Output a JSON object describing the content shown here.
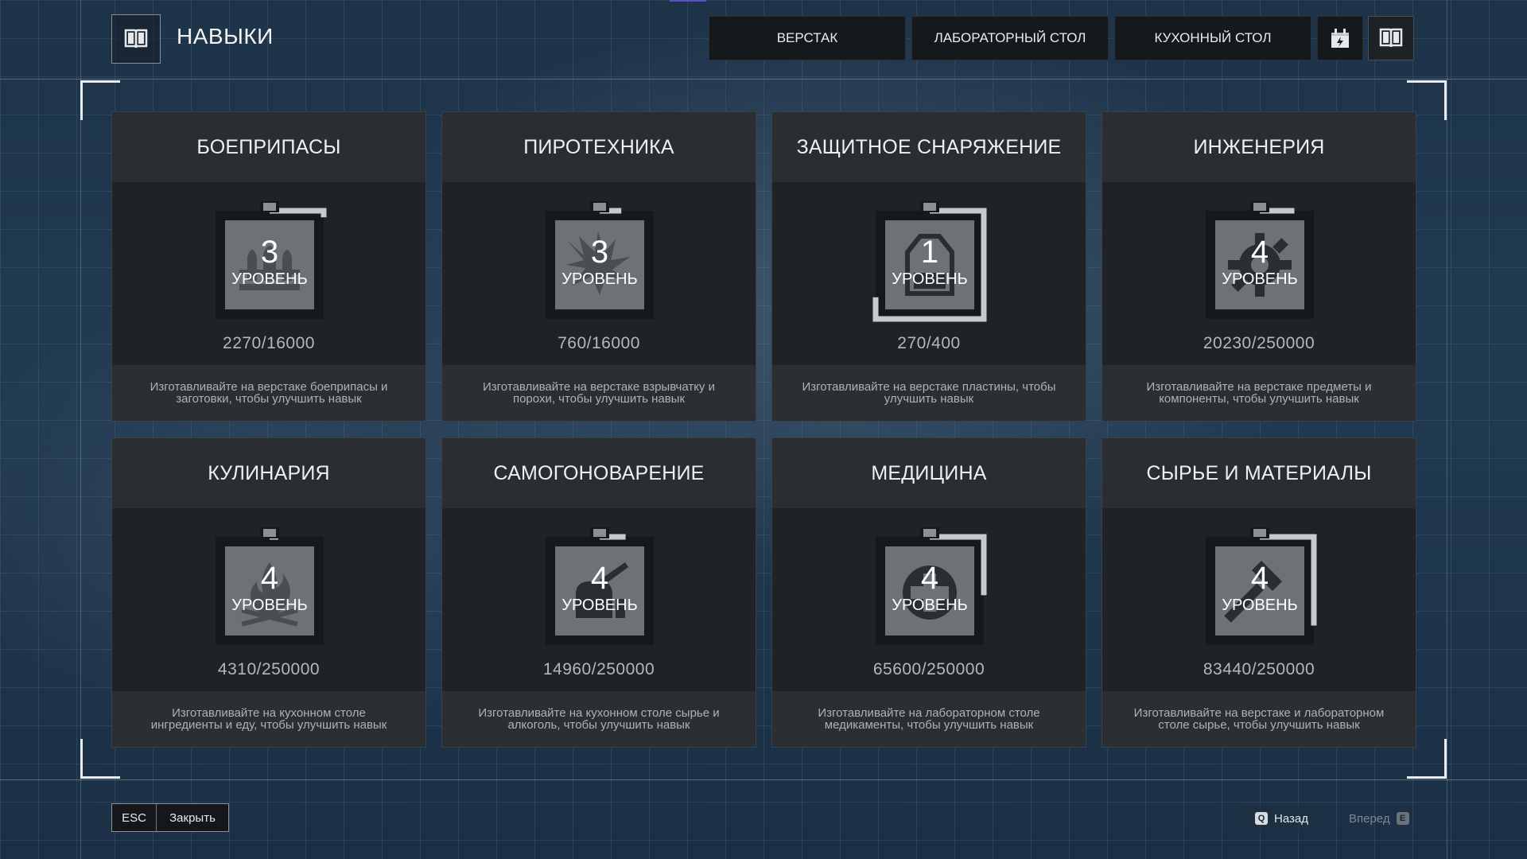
{
  "header": {
    "title": "НАВЫКИ",
    "tabs": [
      {
        "label": "ВЕРСТАК"
      },
      {
        "label": "ЛАБОРАТОРНЫЙ СТОЛ"
      },
      {
        "label": "КУХОННЫЙ СТОЛ"
      }
    ],
    "icons": [
      "calendar-gift-icon",
      "book-icon"
    ]
  },
  "skills": [
    {
      "name": "БОЕПРИПАСЫ",
      "level": "3",
      "level_word": "УРОВЕНЬ",
      "progress": "2270/16000",
      "fraction": 0.14,
      "icon": "ammo-icon",
      "desc": "Изготавливайте на верстаке боеприпасы и заготовки, чтобы улучшить навык"
    },
    {
      "name": "ПИРОТЕХНИКА",
      "level": "3",
      "level_word": "УРОВЕНЬ",
      "progress": "760/16000",
      "fraction": 0.05,
      "icon": "explosion-icon",
      "desc": "Изготавливайте на верстаке взрывчатку и порохи, чтобы улучшить навык"
    },
    {
      "name": "ЗАЩИТНОЕ СНАРЯЖЕНИЕ",
      "level": "1",
      "level_word": "УРОВЕНЬ",
      "progress": "270/400",
      "fraction": 0.675,
      "icon": "armor-plate-icon",
      "desc": "Изготавливайте на верстаке пластины, чтобы улучшить навык"
    },
    {
      "name": "ИНЖЕНЕРИЯ",
      "level": "4",
      "level_word": "УРОВЕНЬ",
      "progress": "20230/250000",
      "fraction": 0.08,
      "icon": "gear-icon",
      "desc": "Изготавливайте на верстаке предметы и компоненты, чтобы улучшить навык"
    },
    {
      "name": "КУЛИНАРИЯ",
      "level": "4",
      "level_word": "УРОВЕНЬ",
      "progress": "4310/250000",
      "fraction": 0.02,
      "icon": "campfire-icon",
      "desc": "Изготавливайте на кухонном столе ингредиенты и еду, чтобы улучшить навык"
    },
    {
      "name": "САМОГОНОВАРЕНИЕ",
      "level": "4",
      "level_word": "УРОВЕНЬ",
      "progress": "14960/250000",
      "fraction": 0.06,
      "icon": "distiller-icon",
      "desc": "Изготавливайте на кухонном столе сырье и алкоголь, чтобы улучшить навык"
    },
    {
      "name": "МЕДИЦИНА",
      "level": "4",
      "level_word": "УРОВЕНЬ",
      "progress": "65600/250000",
      "fraction": 0.26,
      "icon": "medical-cross-icon",
      "desc": "Изготавливайте на лабораторном столе медикаменты, чтобы улучшить навык"
    },
    {
      "name": "СЫРЬЕ И МАТЕРИАЛЫ",
      "level": "4",
      "level_word": "УРОВЕНЬ",
      "progress": "83440/250000",
      "fraction": 0.33,
      "icon": "hammer-icon",
      "desc": "Изготавливайте на верстаке и лабораторном столе сырье, чтобы улучшить навык"
    }
  ],
  "footer": {
    "esc_key": "ESC",
    "close_label": "Закрыть",
    "back_key": "Q",
    "back_label": "Назад",
    "forward_key": "E",
    "forward_label": "Вперед"
  },
  "colors": {
    "accent": "#5a4fc9",
    "card_bg": "#1f2327",
    "badge_fill": "#6e7276",
    "badge_track": "#c7cacd"
  }
}
